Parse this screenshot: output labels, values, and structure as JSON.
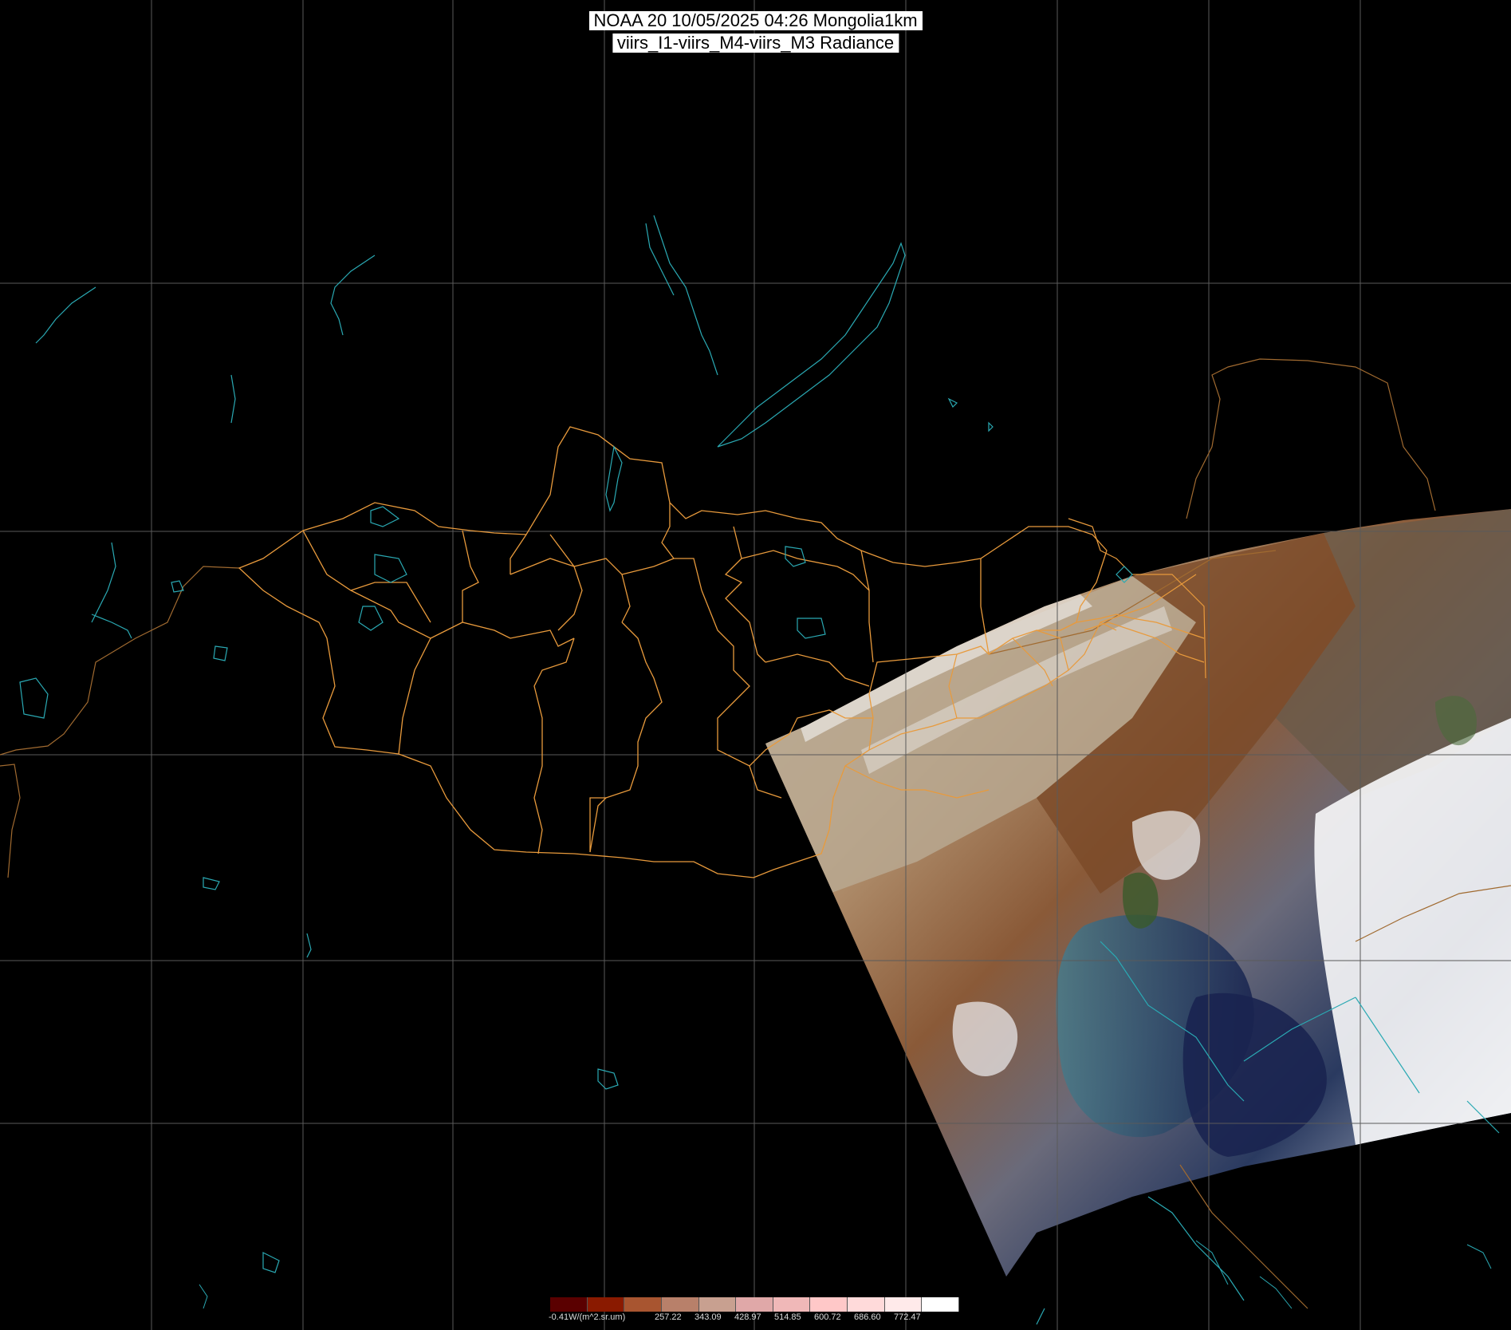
{
  "title": {
    "line1": "NOAA 20 10/05/2025 04:26 Mongolia1km",
    "line2": "viirs_I1-viirs_M4-viirs_M3 Radiance"
  },
  "colors": {
    "background": "#000000",
    "graticule": "#5a5a5a",
    "admin_border": "#e89a3c",
    "coast_water": "#2aa9b3",
    "country_border": "#b07030"
  },
  "colorbar": {
    "unit_label": "-0.41W/(m^2.sr.um)",
    "tick_labels": [
      "257.22",
      "343.09",
      "428.97",
      "514.85",
      "600.72",
      "686.60",
      "772.47"
    ],
    "colors": [
      "#5a0000",
      "#8a1a00",
      "#a85530",
      "#b8806a",
      "#c8a090",
      "#e0a8a8",
      "#f0b8b8",
      "#ffc8c8",
      "#ffdada",
      "#ffeaea",
      "#ffffff"
    ]
  }
}
